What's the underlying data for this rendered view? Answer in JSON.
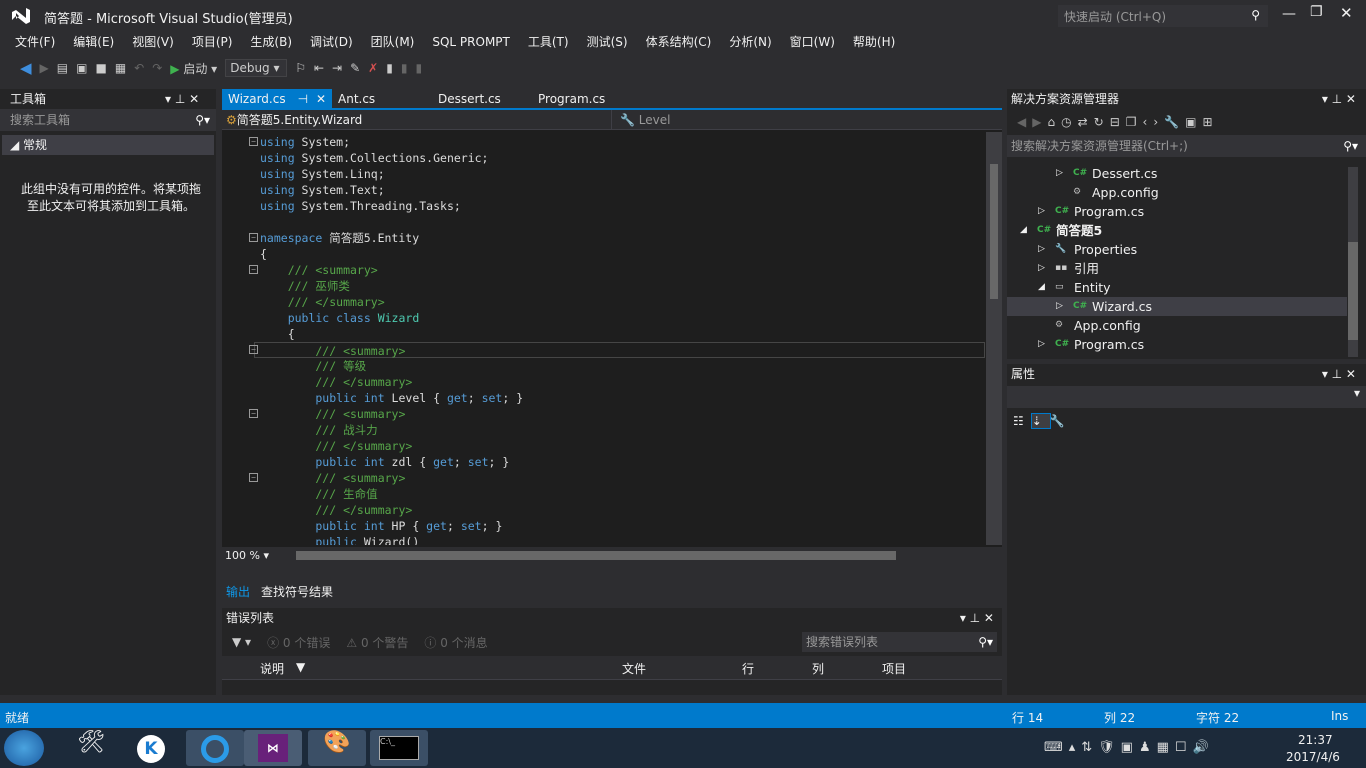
{
  "window": {
    "title": "简答题 - Microsoft Visual Studio(管理员)",
    "quick_launch": "快速启动 (Ctrl+Q)"
  },
  "menu": [
    "文件(F)",
    "编辑(E)",
    "视图(V)",
    "项目(P)",
    "生成(B)",
    "调试(D)",
    "团队(M)",
    "SQL PROMPT",
    "工具(T)",
    "测试(S)",
    "体系结构(C)",
    "分析(N)",
    "窗口(W)",
    "帮助(H)"
  ],
  "toolbar": {
    "start": "启动",
    "config": "Debug"
  },
  "toolbox": {
    "title": "工具箱",
    "search_placeholder": "搜索工具箱",
    "group": "常规",
    "empty_msg": "此组中没有可用的控件。将某项拖至此文本可将其添加到工具箱。"
  },
  "editor": {
    "tabs": [
      "Wizard.cs",
      "Ant.cs",
      "Dessert.cs",
      "Program.cs"
    ],
    "nav_class": "简答题5.Entity.Wizard",
    "nav_member": "Level",
    "zoom": "100 %",
    "current_line": 14,
    "lines": [
      [
        [
          "using",
          "kw"
        ],
        [
          " System;",
          "tx"
        ]
      ],
      [
        [
          "using",
          "kw"
        ],
        [
          " System.Collections.Generic;",
          "tx"
        ]
      ],
      [
        [
          "using",
          "kw"
        ],
        [
          " System.Linq;",
          "tx"
        ]
      ],
      [
        [
          "using",
          "kw"
        ],
        [
          " System.Text;",
          "tx"
        ]
      ],
      [
        [
          "using",
          "kw"
        ],
        [
          " System.Threading.Tasks;",
          "tx"
        ]
      ],
      [],
      [
        [
          "namespace",
          "kw"
        ],
        [
          " 简答题5.Entity",
          "tx"
        ]
      ],
      [
        [
          "{",
          "tx"
        ]
      ],
      [
        [
          "    /// <summary>",
          "cm"
        ]
      ],
      [
        [
          "    /// 巫师类",
          "cm"
        ]
      ],
      [
        [
          "    /// </summary>",
          "cm"
        ]
      ],
      [
        [
          "    public class ",
          "kw"
        ],
        [
          "Wizard",
          "ty"
        ]
      ],
      [
        [
          "    {",
          "tx"
        ]
      ],
      [
        [
          "        /// <summary>",
          "cm"
        ]
      ],
      [
        [
          "        /// 等级",
          "cm"
        ]
      ],
      [
        [
          "        /// </summary>",
          "cm"
        ]
      ],
      [
        [
          "        public int",
          "kw"
        ],
        [
          " Level { ",
          "tx"
        ],
        [
          "get",
          "kw"
        ],
        [
          "; ",
          "tx"
        ],
        [
          "set",
          "kw"
        ],
        [
          "; }",
          "tx"
        ]
      ],
      [
        [
          "        /// <summary>",
          "cm"
        ]
      ],
      [
        [
          "        /// 战斗力",
          "cm"
        ]
      ],
      [
        [
          "        /// </summary>",
          "cm"
        ]
      ],
      [
        [
          "        public int",
          "kw"
        ],
        [
          " zdl { ",
          "tx"
        ],
        [
          "get",
          "kw"
        ],
        [
          "; ",
          "tx"
        ],
        [
          "set",
          "kw"
        ],
        [
          "; }",
          "tx"
        ]
      ],
      [
        [
          "        /// <summary>",
          "cm"
        ]
      ],
      [
        [
          "        /// 生命值",
          "cm"
        ]
      ],
      [
        [
          "        /// </summary>",
          "cm"
        ]
      ],
      [
        [
          "        public int",
          "kw"
        ],
        [
          " HP { ",
          "tx"
        ],
        [
          "get",
          "kw"
        ],
        [
          "; ",
          "tx"
        ],
        [
          "set",
          "kw"
        ],
        [
          "; }",
          "tx"
        ]
      ],
      [
        [
          "        public ",
          "kw"
        ],
        [
          "Wizard()",
          "tx"
        ]
      ]
    ],
    "fold_lines": [
      1,
      7,
      9,
      14,
      18,
      22
    ]
  },
  "output_tabs": [
    "输出",
    "查找符号结果"
  ],
  "error_list": {
    "title": "错误列表",
    "errors": "0 个错误",
    "warnings": "0 个警告",
    "messages": "0 个消息",
    "search_placeholder": "搜索错误列表",
    "columns": [
      "说明",
      "文件",
      "行",
      "列",
      "项目"
    ]
  },
  "solution": {
    "title": "解决方案资源管理器",
    "search_placeholder": "搜索解决方案资源管理器(Ctrl+;)",
    "items": [
      {
        "label": "Dessert.cs",
        "depth": 2,
        "icon": "csharp",
        "expander": "collapsed"
      },
      {
        "label": "App.config",
        "depth": 2,
        "icon": "config",
        "expander": ""
      },
      {
        "label": "Program.cs",
        "depth": 1,
        "icon": "csharp",
        "expander": "collapsed"
      },
      {
        "label": "简答题5",
        "depth": 0,
        "icon": "csproj",
        "expander": "expanded",
        "bold": true
      },
      {
        "label": "Properties",
        "depth": 1,
        "icon": "wrench",
        "expander": "collapsed"
      },
      {
        "label": "引用",
        "depth": 1,
        "icon": "references",
        "expander": "collapsed"
      },
      {
        "label": "Entity",
        "depth": 1,
        "icon": "folder",
        "expander": "expanded"
      },
      {
        "label": "Wizard.cs",
        "depth": 2,
        "icon": "csharp",
        "expander": "collapsed",
        "selected": true
      },
      {
        "label": "App.config",
        "depth": 1,
        "icon": "config",
        "expander": ""
      },
      {
        "label": "Program.cs",
        "depth": 1,
        "icon": "csharp",
        "expander": "collapsed"
      }
    ]
  },
  "properties": {
    "title": "属性"
  },
  "status": {
    "state": "就绪",
    "line": "行 14",
    "col": "列 22",
    "char": "字符 22",
    "mode": "Ins"
  },
  "taskbar": {
    "time": "21:37",
    "date": "2017/4/6"
  },
  "colors": {
    "accent": "#007acc",
    "keyword": "#569cd6",
    "comment": "#57a64a",
    "type": "#4ec9b0"
  }
}
